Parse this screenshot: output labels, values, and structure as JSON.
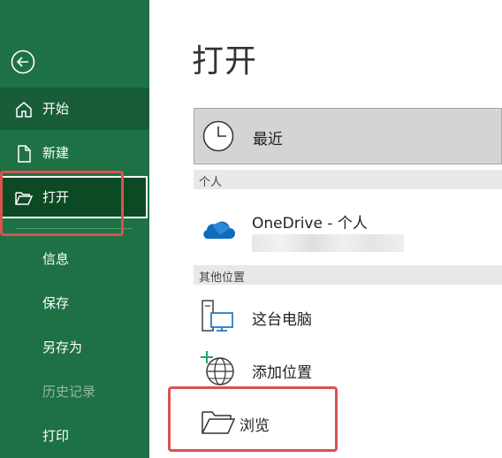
{
  "sidebar": {
    "back_icon": "back-arrow-icon",
    "items": [
      {
        "label": "开始",
        "icon": "home-icon"
      },
      {
        "label": "新建",
        "icon": "new-file-icon"
      },
      {
        "label": "打开",
        "icon": "open-folder-icon"
      },
      {
        "label": "信息"
      },
      {
        "label": "保存"
      },
      {
        "label": "另存为"
      },
      {
        "label": "历史记录"
      },
      {
        "label": "打印"
      }
    ]
  },
  "main": {
    "title": "打开",
    "recent_label": "最近",
    "personal_header": "个人",
    "onedrive_label": "OneDrive - 个人",
    "other_header": "其他位置",
    "this_pc_label": "这台电脑",
    "add_location_label": "添加位置",
    "browse_label": "浏览"
  },
  "colors": {
    "sidebar_bg": "#1e7145",
    "sidebar_active": "#185d38",
    "sidebar_selected": "#0c4a24",
    "highlight_red": "#d9534f"
  }
}
